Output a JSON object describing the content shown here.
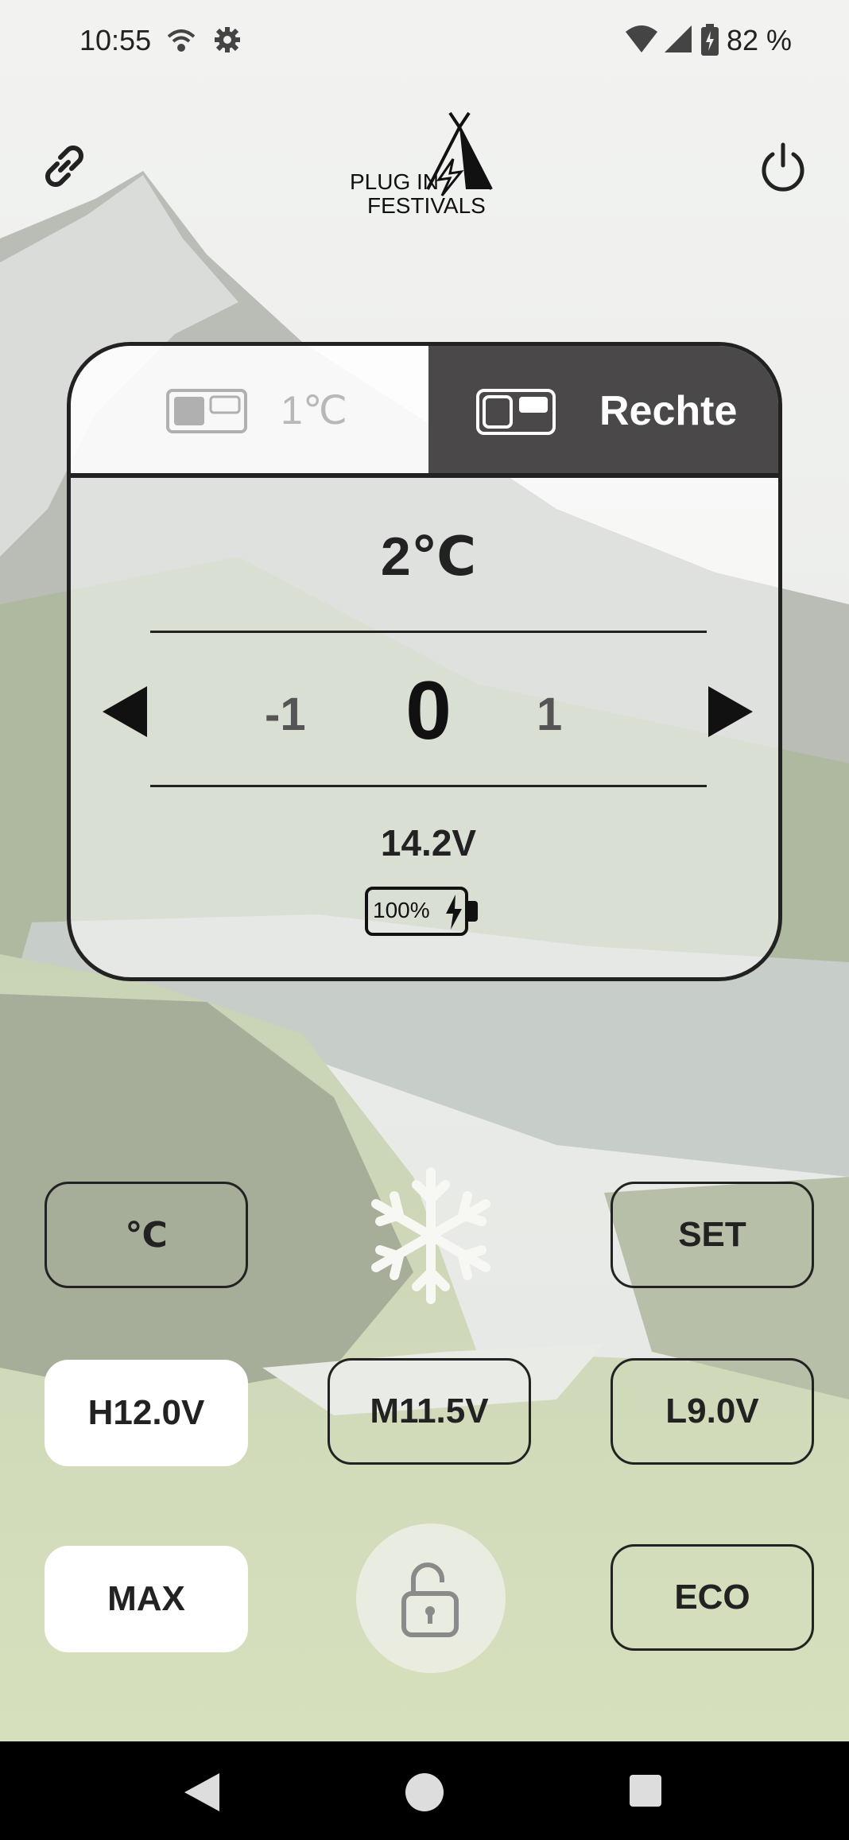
{
  "status_bar": {
    "time": "10:55",
    "battery_percent": "82 %",
    "icons": [
      "wifi-calling-icon",
      "settings-icon",
      "wifi-icon",
      "cell-signal-icon",
      "battery-charging-icon"
    ]
  },
  "header": {
    "logo_line1": "PLUG IN",
    "logo_line2": "FESTIVALS",
    "link_icon": "link-icon",
    "power_icon": "power-icon"
  },
  "panel": {
    "tabs": [
      {
        "temp": "1℃",
        "icon": "left-compartment-icon",
        "active": false
      },
      {
        "label": "Rechte",
        "icon": "right-compartment-icon",
        "active": true
      }
    ],
    "target_temp": "2℃",
    "picker": {
      "prev": "-1",
      "current": "0",
      "next": "1"
    },
    "voltage": "14.2V",
    "battery": "100%"
  },
  "controls": {
    "unit_button": "℃",
    "snowflake_icon": "snowflake-icon",
    "set_button": "SET",
    "battery_protection": [
      {
        "label": "H12.0V",
        "selected": true
      },
      {
        "label": "M11.5V",
        "selected": false
      },
      {
        "label": "L9.0V",
        "selected": false
      }
    ],
    "max_button": "MAX",
    "lock_icon": "unlock-icon",
    "eco_button": "ECO"
  },
  "nav": {
    "back": "back-icon",
    "home": "home-icon",
    "recents": "recents-icon"
  },
  "colors": {
    "dark": "#222222",
    "tab_active_bg": "#4a4848",
    "nav_bg": "#000000"
  }
}
